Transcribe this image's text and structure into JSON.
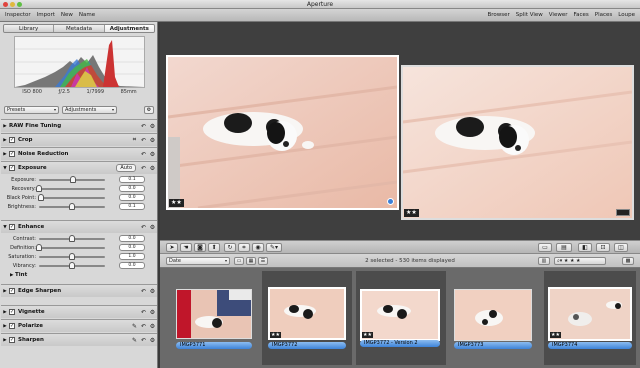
{
  "window": {
    "title": "Aperture"
  },
  "toolbar": {
    "left": [
      "Inspector",
      "Import",
      "New",
      "Name"
    ],
    "right": [
      "Browser",
      "Split View",
      "Viewer",
      "Faces",
      "Places",
      "Loupe"
    ]
  },
  "inspector": {
    "tabs": [
      "Library",
      "Metadata",
      "Adjustments"
    ],
    "active_tab": "Adjustments",
    "exif": [
      "ISO 800",
      "ƒ/2.5",
      "1/7999",
      "85mm"
    ],
    "presets_label": "Presets",
    "adjustments_label": "Adjustments",
    "bricks": [
      {
        "label": "RAW Fine Tuning",
        "checked": false,
        "expanded": false
      },
      {
        "label": "Crop",
        "checked": true,
        "expanded": false
      },
      {
        "label": "Noise Reduction",
        "checked": true,
        "expanded": false
      },
      {
        "label": "Exposure",
        "checked": true,
        "expanded": true,
        "auto": "Auto"
      },
      {
        "label": "Enhance",
        "checked": true,
        "expanded": true
      },
      {
        "label": "Edge Sharpen",
        "checked": true,
        "expanded": false
      },
      {
        "label": "Vignette",
        "checked": true,
        "expanded": false
      },
      {
        "label": "Polarize",
        "checked": true,
        "expanded": false
      },
      {
        "label": "Sharpen",
        "checked": true,
        "expanded": false
      }
    ],
    "exposure_sliders": [
      {
        "label": "Exposure:",
        "value": "0.1",
        "level": 0.52
      },
      {
        "label": "Recovery:",
        "value": "0.0",
        "level": 0.0
      },
      {
        "label": "Black Point:",
        "value": "0.0",
        "level": 0.03
      },
      {
        "label": "Brightness:",
        "value": "0.1",
        "level": 0.5
      }
    ],
    "enhance_sliders": [
      {
        "label": "Contrast:",
        "value": "0.0",
        "level": 0.5
      },
      {
        "label": "Definition:",
        "value": "0.0",
        "level": 0.0
      },
      {
        "label": "Saturation:",
        "value": "1.0",
        "level": 0.5
      },
      {
        "label": "Vibrancy:",
        "value": "0.0",
        "level": 0.5
      }
    ],
    "tint_label": "Tint"
  },
  "viewer": {
    "photos": [
      {
        "name": "IMGP3772",
        "stars": "★★",
        "selected": true
      },
      {
        "name": "IMGP3772 - Version 2",
        "stars": "★★",
        "selected": false
      }
    ]
  },
  "browser": {
    "sort": "Date",
    "status": "2 selected - 530 items displayed",
    "filter_stars": "★ ★ ★"
  },
  "filmstrip": [
    {
      "name": "IMGP3771",
      "stars": "",
      "selected": false
    },
    {
      "name": "IMGP3772",
      "stars": "★★",
      "selected": true
    },
    {
      "name": "IMGP3772 - Version 2",
      "stars": "★★",
      "selected": true
    },
    {
      "name": "IMGP3773",
      "stars": "",
      "selected": false
    },
    {
      "name": "IMGP3774",
      "stars": "★★",
      "selected": true
    }
  ],
  "colors": {
    "accent": "#3d83d8",
    "panel": "#d8d8d8",
    "viewer_bg": "#3f3f3f"
  },
  "icons": [
    "histogram-icon",
    "gear-icon",
    "crop-icon",
    "eye-icon",
    "brush-icon",
    "arrow-icon",
    "rotate-icon"
  ]
}
